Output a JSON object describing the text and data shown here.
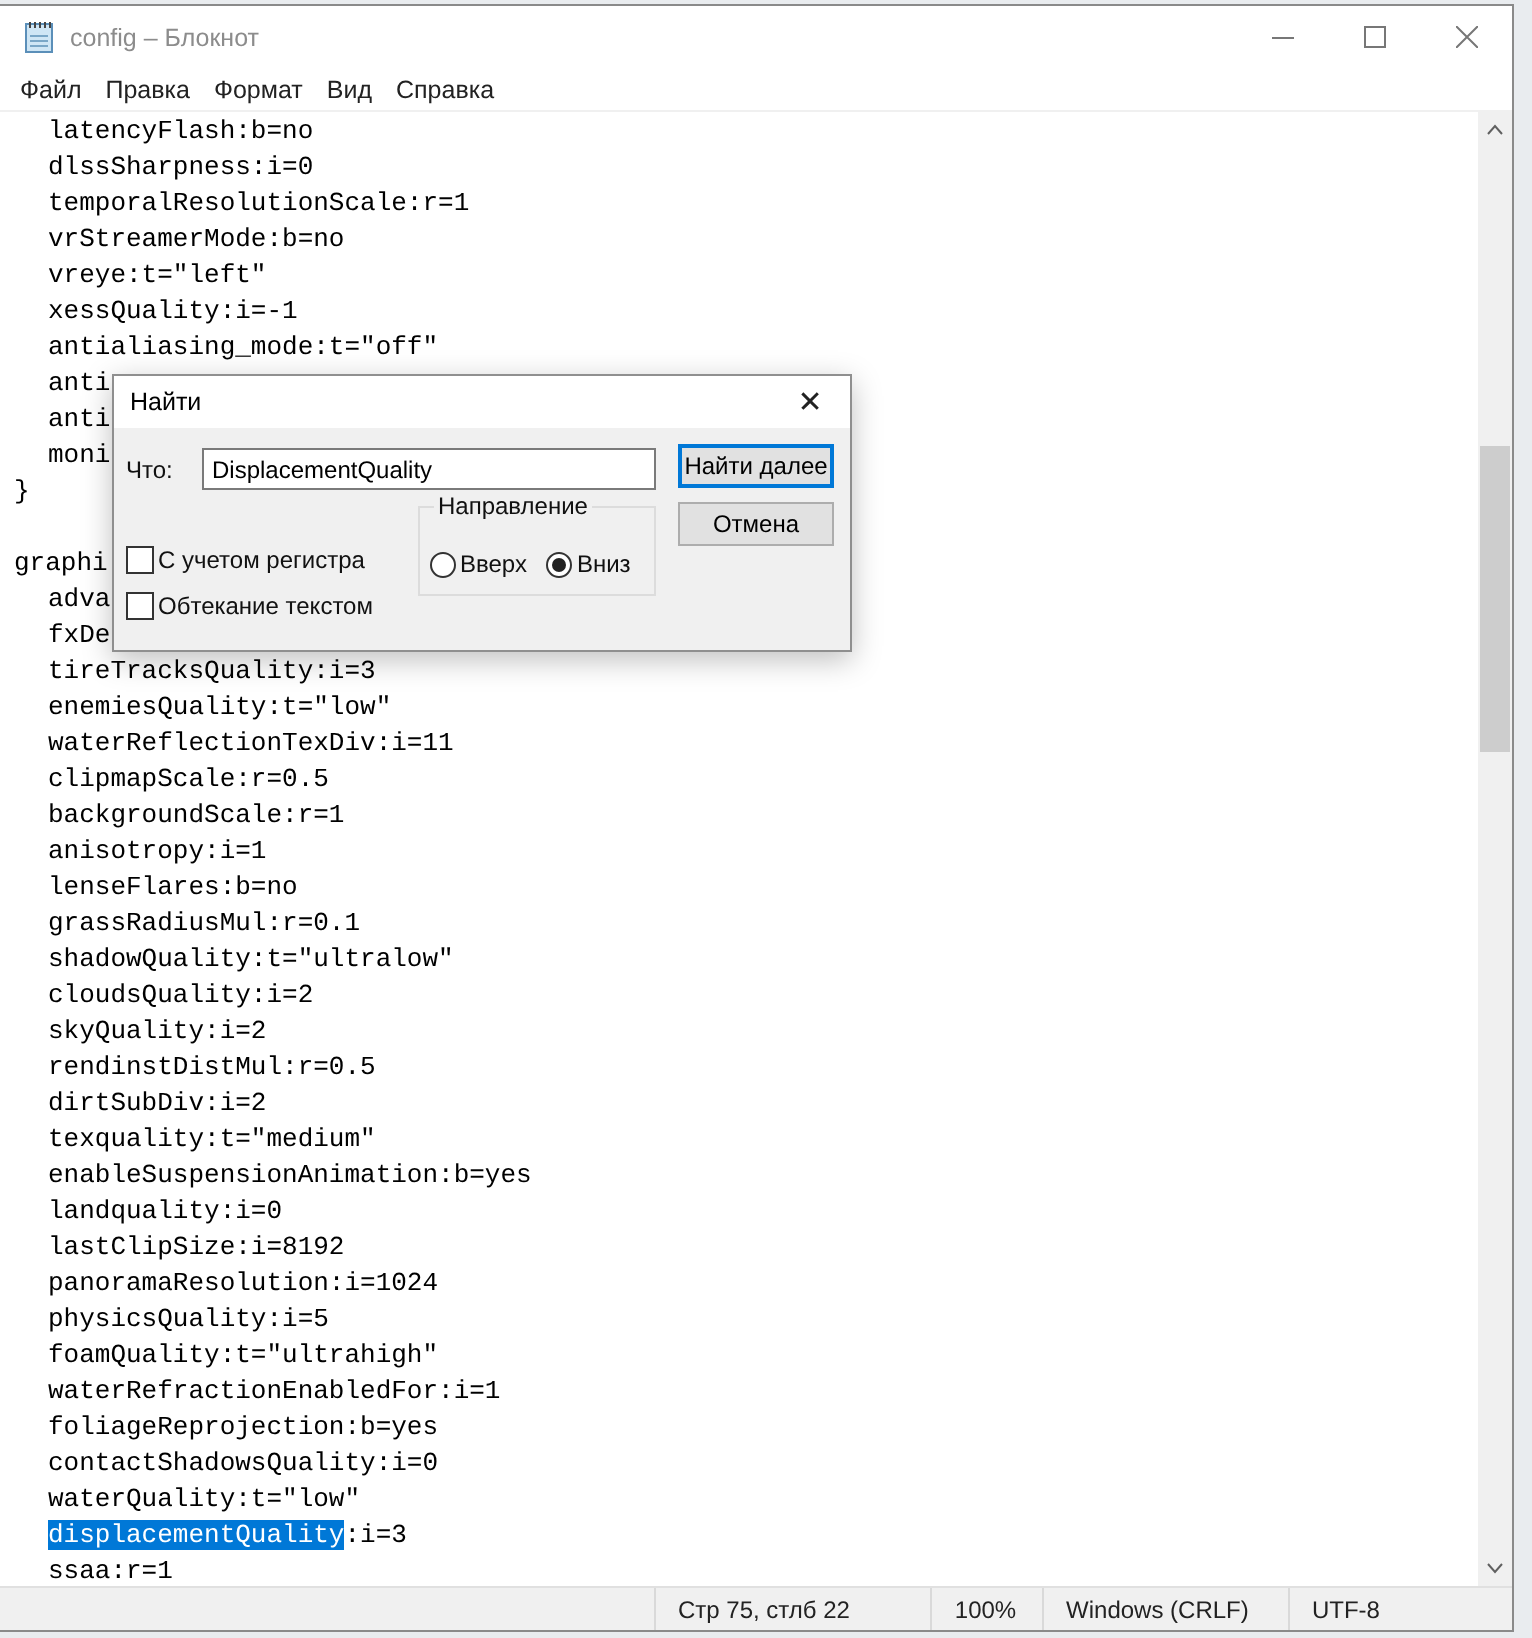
{
  "window": {
    "title": "config – Блокнот"
  },
  "menu": [
    "Файл",
    "Правка",
    "Формат",
    "Вид",
    "Справка"
  ],
  "editor": {
    "blocks": [
      {
        "children": [
          {
            "text": "latencyFlash:b=no"
          },
          {
            "text": "dlssSharpness:i=0"
          },
          {
            "text": "temporalResolutionScale:r=1"
          },
          {
            "text": "vrStreamerMode:b=no"
          },
          {
            "text": "vreye:t=\"left\""
          },
          {
            "text": "xessQuality:i=-1"
          },
          {
            "text": "antialiasing_mode:t=\"off\""
          },
          {
            "text": "anti"
          },
          {
            "text": "anti"
          },
          {
            "text": "moni"
          }
        ],
        "closing": "}"
      },
      {
        "header": "graphi",
        "children": [
          {
            "text": "adva"
          },
          {
            "text": "fxDe"
          },
          {
            "text": "tireTracksQuality:i=3"
          },
          {
            "text": "enemiesQuality:t=\"low\""
          },
          {
            "text": "waterReflectionTexDiv:i=11"
          },
          {
            "text": "clipmapScale:r=0.5"
          },
          {
            "text": "backgroundScale:r=1"
          },
          {
            "text": "anisotropy:i=1"
          },
          {
            "text": "lenseFlares:b=no"
          },
          {
            "text": "grassRadiusMul:r=0.1"
          },
          {
            "text": "shadowQuality:t=\"ultralow\""
          },
          {
            "text": "cloudsQuality:i=2"
          },
          {
            "text": "skyQuality:i=2"
          },
          {
            "text": "rendinstDistMul:r=0.5"
          },
          {
            "text": "dirtSubDiv:i=2"
          },
          {
            "text": "texquality:t=\"medium\""
          },
          {
            "text": "enableSuspensionAnimation:b=yes"
          },
          {
            "text": "landquality:i=0"
          },
          {
            "text": "lastClipSize:i=8192"
          },
          {
            "text": "panoramaResolution:i=1024"
          },
          {
            "text": "physicsQuality:i=5"
          },
          {
            "text": "foamQuality:t=\"ultrahigh\""
          },
          {
            "text": "waterRefractionEnabledFor:i=1"
          },
          {
            "text": "foliageReprojection:b=yes"
          },
          {
            "text": "contactShadowsQuality:i=0"
          },
          {
            "text": "waterQuality:t=\"low\""
          },
          {
            "segments": [
              {
                "text": "displacementQuality",
                "selected": true
              },
              {
                "text": ":i=3",
                "selected": false
              }
            ]
          },
          {
            "text": "ssaa:r=1"
          }
        ]
      }
    ]
  },
  "find_dialog": {
    "title": "Найти",
    "close": "✕",
    "find_label": "Что:",
    "find_value": "DisplacementQuality",
    "buttons": [
      {
        "label": "Найти далее",
        "default": true
      },
      {
        "label": "Отмена",
        "default": false
      }
    ],
    "direction": {
      "label": "Направление",
      "options": [
        {
          "label": "Вверх",
          "selected": false
        },
        {
          "label": "Вниз",
          "selected": true
        }
      ]
    },
    "checkboxes": [
      {
        "label": "С учетом регистра",
        "checked": false
      },
      {
        "label": "Обтекание текстом",
        "checked": false
      }
    ]
  },
  "status_bar": [
    "Стр 75, стлб 22",
    "100%",
    "Windows (CRLF)",
    "UTF-8"
  ]
}
